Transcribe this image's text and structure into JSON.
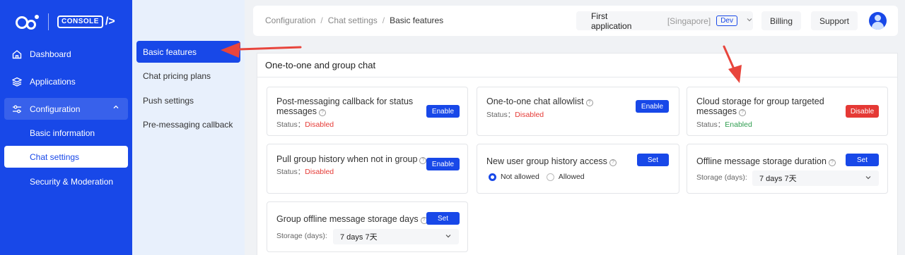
{
  "brand": {
    "console_label": "CONSOLE",
    "console_suffix": "/>"
  },
  "sidebar": {
    "items": [
      {
        "label": "Dashboard",
        "icon": "home-icon"
      },
      {
        "label": "Applications",
        "icon": "layers-icon"
      },
      {
        "label": "Configuration",
        "icon": "sliders-icon",
        "expanded": true
      }
    ],
    "sub_items": [
      {
        "label": "Basic information"
      },
      {
        "label": "Chat settings",
        "active": true
      },
      {
        "label": "Security & Moderation"
      }
    ]
  },
  "subnav": {
    "items": [
      {
        "label": "Basic features",
        "active": true
      },
      {
        "label": "Chat pricing plans"
      },
      {
        "label": "Push settings"
      },
      {
        "label": "Pre-messaging callback"
      }
    ]
  },
  "header": {
    "breadcrumb": [
      "Configuration",
      "Chat settings",
      "Basic features"
    ],
    "breadcrumb_sep": "/",
    "app_name": "First application",
    "region": "[Singapore]",
    "env": "Dev",
    "billing": "Billing",
    "support": "Support"
  },
  "section": {
    "title": "One-to-one and group chat",
    "status_label": "Status：",
    "storage_label": "Storage (days):",
    "cards": {
      "post_callback": {
        "title": "Post-messaging callback for status messages",
        "status": "Disabled",
        "button": "Enable"
      },
      "allowlist": {
        "title": "One-to-one chat allowlist",
        "status": "Disabled",
        "button": "Enable"
      },
      "cloud_storage": {
        "title": "Cloud storage for group targeted messages",
        "status": "Enabled",
        "button": "Disable"
      },
      "pull_history": {
        "title": "Pull group history when not in group",
        "status": "Disabled",
        "button": "Enable"
      },
      "new_user_history": {
        "title": "New user group history access",
        "button": "Set",
        "options": [
          "Not allowed",
          "Allowed"
        ],
        "selected": "Not allowed"
      },
      "offline_storage": {
        "title": "Offline message storage duration",
        "button": "Set",
        "value": "7 days 7天"
      },
      "group_offline_storage": {
        "title": "Group offline message storage days",
        "button": "Set",
        "value": "7 days 7天"
      }
    }
  },
  "colors": {
    "primary": "#1848e8",
    "danger": "#e53935",
    "success": "#2e9d4f",
    "annotation": "#e8453c"
  }
}
